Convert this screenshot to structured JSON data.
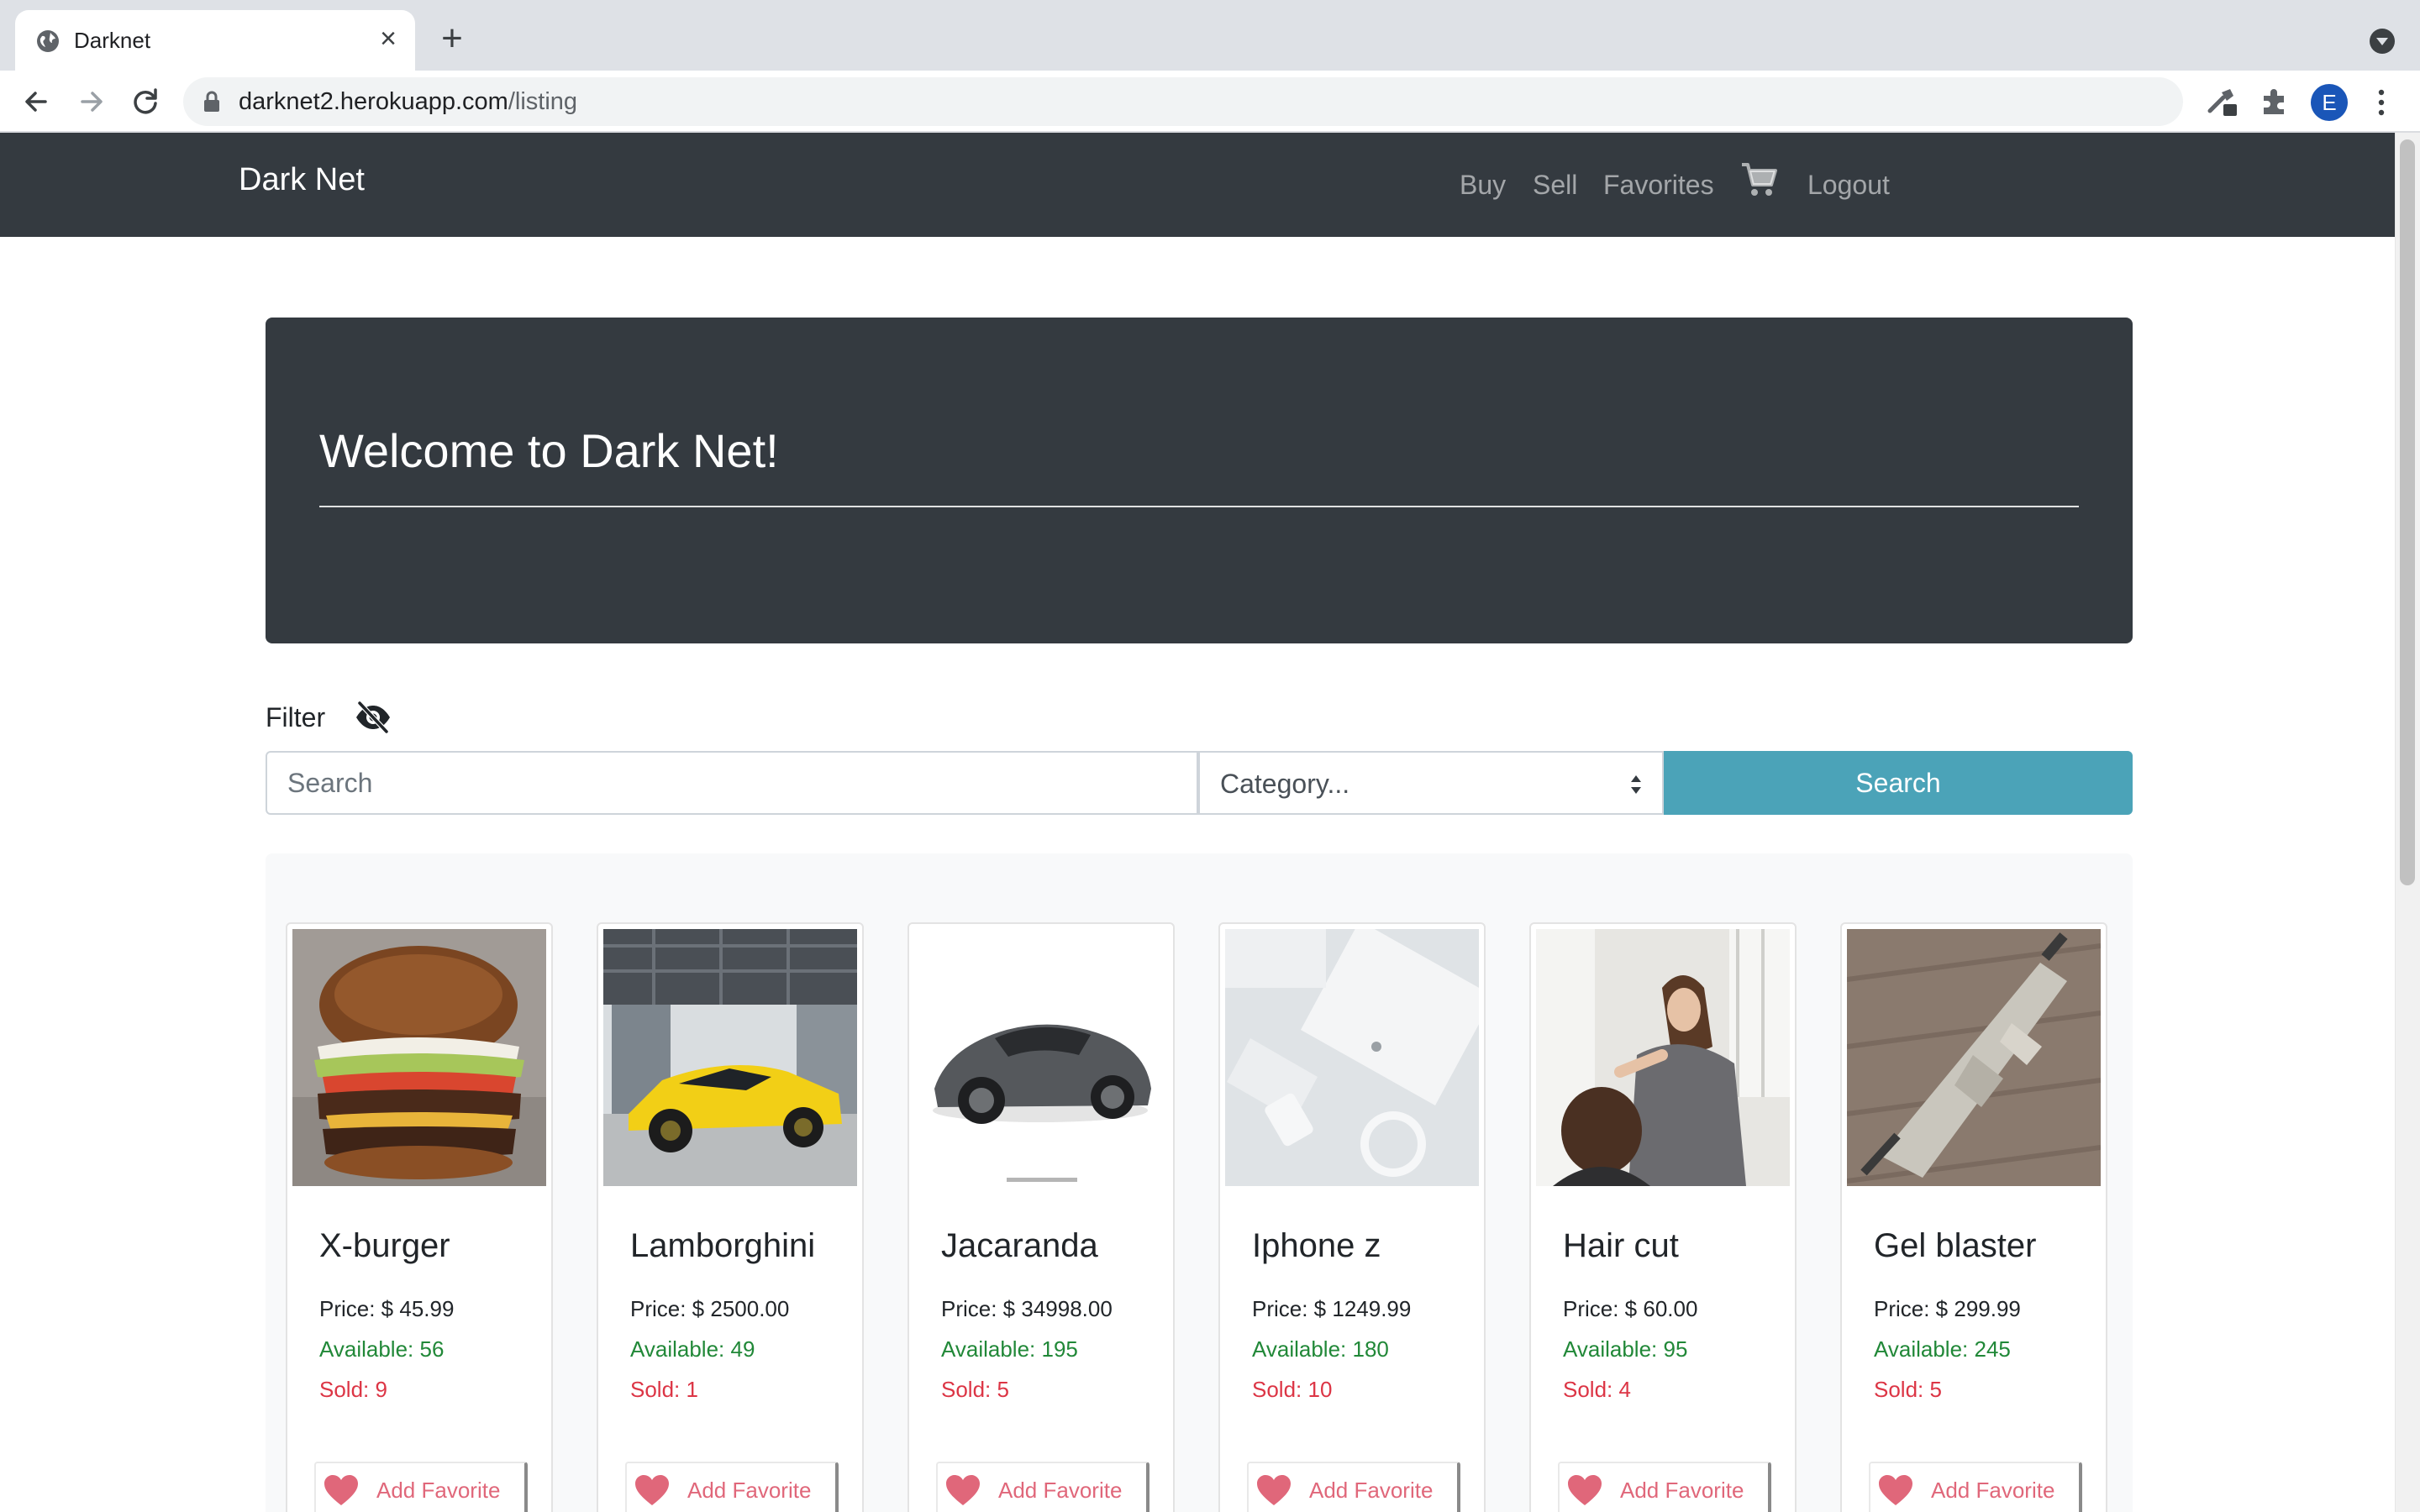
{
  "browser": {
    "tab_title": "Darknet",
    "url_domain": "darknet2.herokuapp.com",
    "url_path": "/listing",
    "profile_initial": "E"
  },
  "navbar": {
    "brand": "Dark Net",
    "links": [
      "Buy",
      "Sell",
      "Favorites",
      "Logout"
    ],
    "cart_icon": "shopping-cart-icon"
  },
  "jumbotron": {
    "title": "Welcome to Dark Net!"
  },
  "filter": {
    "label": "Filter",
    "toggle_icon": "eye-slash-icon",
    "search_placeholder": "Search",
    "category_selected": "Category...",
    "search_button": "Search"
  },
  "colors": {
    "navbar_bg": "#343a40",
    "search_button": "#4ba3b8",
    "available_text": "#218838",
    "sold_text": "#dc3545",
    "favorite": "#e0677a"
  },
  "products": [
    {
      "name": "X-burger",
      "price": "Price: $ 45.99",
      "available": "Available: 56",
      "sold": "Sold: 9",
      "favorite_label": "Add Favorite",
      "image": "burger-photo"
    },
    {
      "name": "Lamborghini",
      "price": "Price: $ 2500.00",
      "available": "Available: 49",
      "sold": "Sold: 1",
      "favorite_label": "Add Favorite",
      "image": "yellow-sports-car-photo"
    },
    {
      "name": "Jacaranda",
      "price": "Price: $ 34998.00",
      "available": "Available: 195",
      "sold": "Sold: 5",
      "favorite_label": "Add Favorite",
      "image": "grey-car-render"
    },
    {
      "name": "Iphone z",
      "price": "Price: $ 1249.99",
      "available": "Available: 180",
      "sold": "Sold: 10",
      "favorite_label": "Add Favorite",
      "image": "white-phone-photo"
    },
    {
      "name": "Hair cut",
      "price": "Price: $ 60.00",
      "available": "Available: 95",
      "sold": "Sold: 4",
      "favorite_label": "Add Favorite",
      "image": "hairdresser-photo"
    },
    {
      "name": "Gel blaster",
      "price": "Price: $ 299.99",
      "available": "Available: 245",
      "sold": "Sold: 5",
      "favorite_label": "Add Favorite",
      "image": "toy-rifle-photo"
    }
  ]
}
